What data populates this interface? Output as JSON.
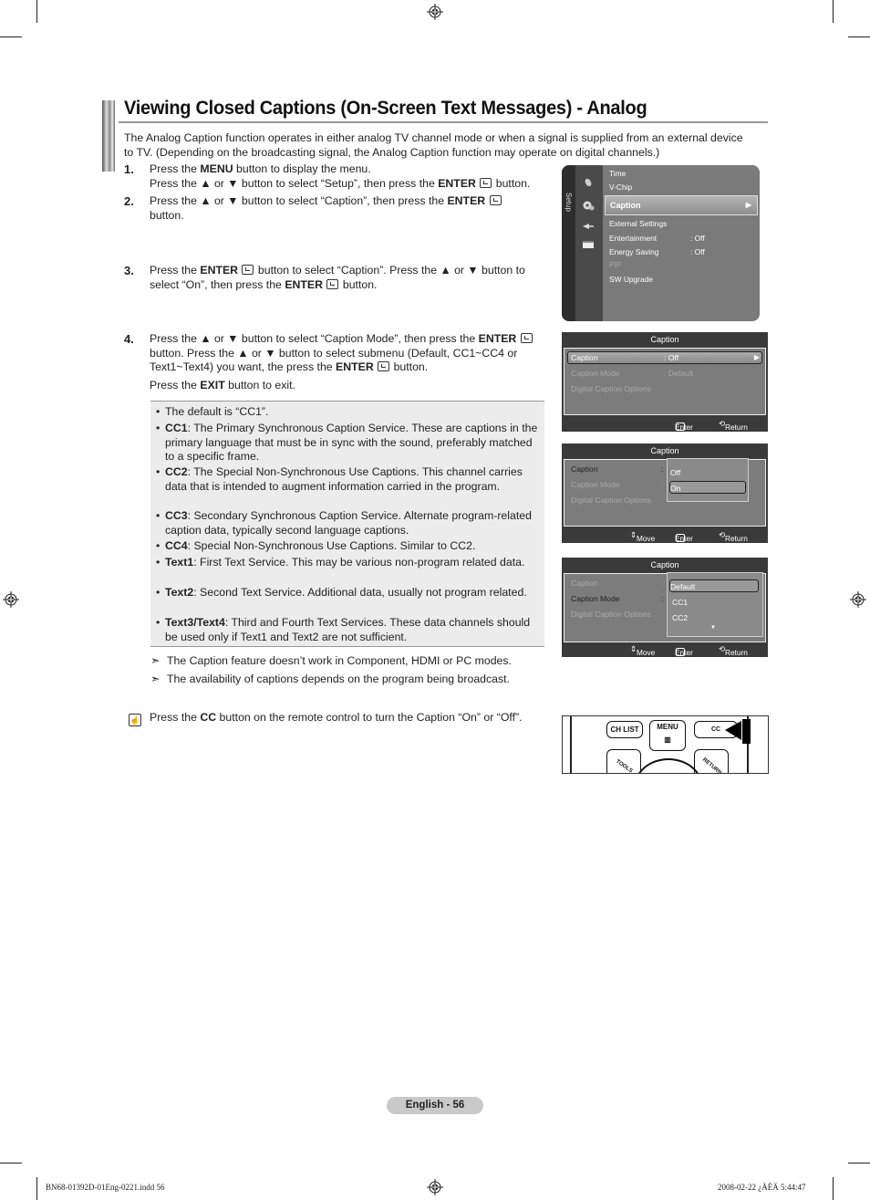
{
  "page": {
    "title": "Viewing Closed Captions (On-Screen Text Messages) - Analog",
    "intro": "The Analog Caption function operates in either analog TV channel mode or when a signal is supplied from an external device to TV. (Depending on the broadcasting signal, the Analog Caption function may operate on digital channels.)",
    "steps": [
      {
        "num": "1.",
        "parts": [
          "Press the ",
          "MENU",
          " button to display the menu.",
          "Press the ▲ or ▼ button to select “Setup”, then press the ",
          "ENTER",
          " button."
        ]
      },
      {
        "num": "2.",
        "parts": [
          "Press the ▲ or ▼ button to select “Caption”, then press the ",
          "ENTER",
          "button."
        ]
      },
      {
        "num": "3.",
        "parts": [
          "Press the ",
          "ENTER",
          " button to select “Caption”. Press the ▲ or ▼ button to select “On”, then press the ",
          "ENTER",
          " button."
        ]
      },
      {
        "num": "4.",
        "parts": [
          "Press the ▲ or ▼ button to select “Caption Mode”, then press the ",
          "ENTER",
          " button. Press the ▲ or ▼ button to select submenu (Default, CC1~CC4 or Text1~Text4) you want, the press the ",
          "ENTER",
          " button.",
          "Press the ",
          "EXIT",
          " button to exit."
        ]
      }
    ],
    "bullets": [
      {
        "term": "",
        "text": "The default is “CC1”."
      },
      {
        "term": "CC1",
        "text": ": The Primary Synchronous Caption Service. These are captions in the primary language that must be in sync with the sound, preferably matched to a specific frame."
      },
      {
        "term": "CC2",
        "text": ": The Special Non-Synchronous Use Captions. This channel carries data that is intended to augment information carried in the program."
      },
      {
        "term": "CC3",
        "text": ": Secondary Synchronous Caption Service. Alternate program-related caption data, typically second language captions."
      },
      {
        "term": "CC4",
        "text": ": Special Non-Synchronous Use Captions. Similar to CC2."
      },
      {
        "term": "Text1",
        "text": ": First Text Service. This may be various non-program related data."
      },
      {
        "term": "Text2",
        "text": ": Second Text Service. Additional data, usually not program related."
      },
      {
        "term": "Text3/Text4",
        "text": ": Third and Fourth Text Services. These data channels should be used only if Text1 and Text2 are not sufficient."
      }
    ],
    "notes": [
      "The Caption feature doesn’t work in Component, HDMI or PC modes.",
      "The availability of captions depends on the program being broadcast."
    ],
    "tip": {
      "pre": "Press the ",
      "bold": "CC",
      "post": " button on the remote control to turn the Caption “On” or “Off”."
    },
    "bullet_glyph": "•",
    "note_glyph": "➣"
  },
  "setup_menu": {
    "side_label": "Setup",
    "items": [
      {
        "label": "Time",
        "value": ""
      },
      {
        "label": "V-Chip",
        "value": ""
      },
      {
        "label": "Caption",
        "value": "",
        "selected": true
      },
      {
        "label": "External Settings",
        "value": ""
      },
      {
        "label": "Entertainment",
        "value": ": Off"
      },
      {
        "label": "Energy Saving",
        "value": ": Off"
      },
      {
        "label": "PIP",
        "value": "",
        "disabled": true
      },
      {
        "label": "SW Upgrade",
        "value": ""
      }
    ],
    "arrow": "▶"
  },
  "caption_screens": [
    {
      "header": "Caption",
      "rows": [
        {
          "label": "Caption",
          "value": ": Off"
        },
        {
          "label": "Caption Mode",
          "value": ": Default"
        },
        {
          "label": "Digital Caption Options",
          "value": ""
        }
      ],
      "footer": {
        "enter": "Enter",
        "return": "Return"
      }
    },
    {
      "header": "Caption",
      "rows": [
        {
          "label": "Caption",
          "value": ":"
        },
        {
          "label": "Caption Mode",
          "value": ":"
        },
        {
          "label": "Digital Caption Options",
          "value": ""
        }
      ],
      "popup_options": [
        "Off",
        "On"
      ],
      "popup_selected": "On",
      "footer": {
        "move": "Move",
        "enter": "Enter",
        "return": "Return"
      }
    },
    {
      "header": "Caption",
      "rows": [
        {
          "label": "Caption",
          "value": ":"
        },
        {
          "label": "Caption Mode",
          "value": ":"
        },
        {
          "label": "Digital Caption Options",
          "value": ""
        }
      ],
      "popup_options": [
        "Default",
        "CC1",
        "CC2"
      ],
      "popup_selected": "Default",
      "footer": {
        "move": "Move",
        "enter": "Enter",
        "return": "Return"
      }
    }
  ],
  "remote": {
    "buttons": [
      "CH LIST",
      "MENU",
      "CC",
      "TOOLS",
      "RETURN"
    ]
  },
  "footer": {
    "page_badge": "English - 56",
    "file": "BN68-01392D-01Eng-0221.indd   56",
    "timestamp": "2008-02-22   ¿ÀÈÄ 5:44:47"
  },
  "colors": {
    "badge": "#c9c9c9",
    "osd_dark": "#3a3a3a",
    "osd_body": "#7c7c7c",
    "infobox": "#ececec"
  }
}
